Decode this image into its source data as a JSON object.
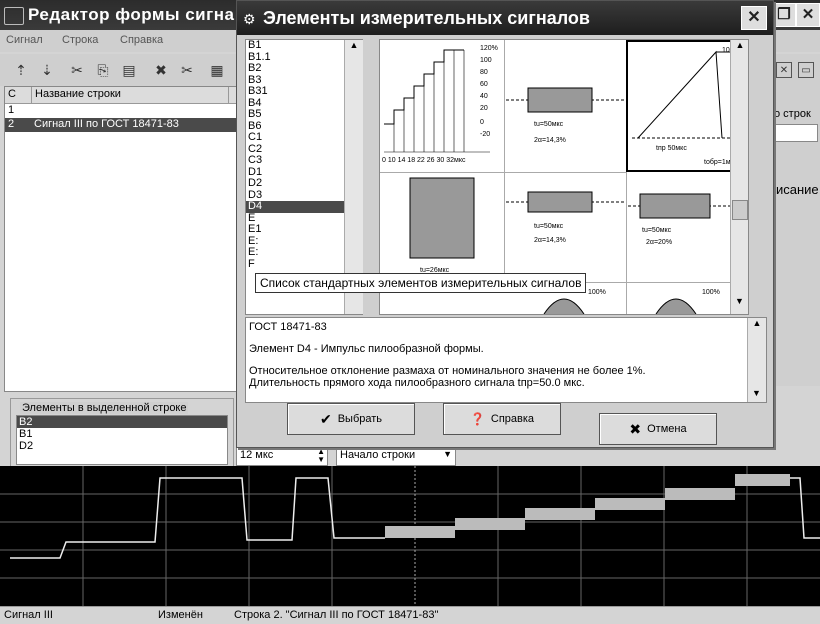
{
  "main": {
    "title": "Редактор формы сигна",
    "menu": [
      "Сигнал",
      "Строка",
      "Справка"
    ],
    "table": {
      "headers": [
        "С",
        "Название строки"
      ],
      "rows": [
        {
          "num": "1",
          "name": ""
        },
        {
          "num": "2",
          "name": "Сигнал III по ГОСТ 18471-83"
        }
      ]
    },
    "right_labels": {
      "rows": "о строк",
      "desc": "исание"
    },
    "elements_label": "Элементы в выделенной строке",
    "elements": [
      "B2",
      "B1",
      "D2"
    ],
    "zero_label": "0",
    "duration_value": "12 мкс",
    "position_select": "Начало строки",
    "status": {
      "signal": "Сигнал III",
      "state": "Изменён",
      "row": "Строка 2. \"Сигнал III по ГОСТ 18471-83\""
    }
  },
  "dialog": {
    "title": "Элементы измерительных сигналов",
    "codes": [
      "B1",
      "B1.1",
      "B2",
      "B3",
      "B31",
      "B4",
      "B5",
      "B6",
      "C1",
      "C2",
      "C3",
      "D1",
      "D2",
      "D3",
      "D4",
      "E",
      "E1",
      "E:",
      "E:",
      "F"
    ],
    "selected_code": "D4",
    "tooltip": "Список стандартных элементов измерительных сигналов",
    "thumb_labels": {
      "t1_scale": [
        "120%",
        "100",
        "80",
        "60",
        "40",
        "20",
        "0",
        "-20"
      ],
      "t1_axis": "0  10  14  18  22  26  30  32мкс",
      "tu50": "tu=50мкс",
      "a143": "2α=14,3%",
      "a20": "2α=20%",
      "tnr": "tпр  50мкс",
      "tobr": "tобр=1мкс",
      "p100": "100%",
      "tu26": "tu=26мкс"
    },
    "description": [
      "ГОСТ 18471-83",
      "",
      "Элемент D4 - Импульс пилообразной формы.",
      "",
      "Относительное отклонение размаха от номинального значения не более 1%.",
      "Длительность прямого хода пилообразного сигнала tпр=50.0 мкс."
    ],
    "buttons": {
      "select": "Выбрать",
      "help": "Справка",
      "cancel": "Отмена"
    }
  }
}
